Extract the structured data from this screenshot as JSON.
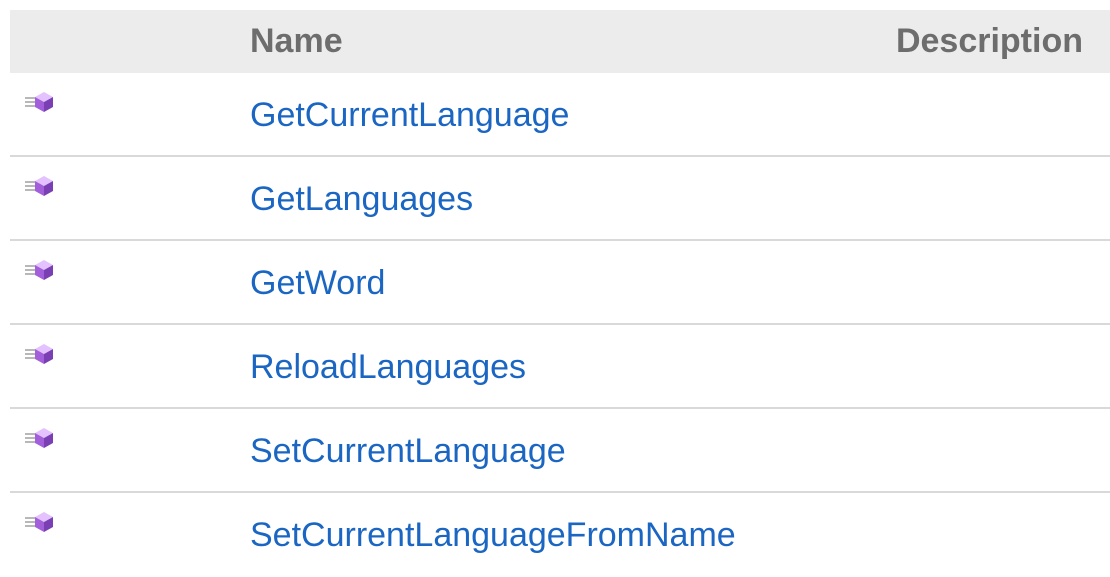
{
  "table": {
    "headers": {
      "icon": "",
      "name": "Name",
      "description": "Description"
    },
    "rows": [
      {
        "icon": "public-method-icon",
        "name": "GetCurrentLanguage",
        "description": ""
      },
      {
        "icon": "public-method-icon",
        "name": "GetLanguages",
        "description": ""
      },
      {
        "icon": "public-method-icon",
        "name": "GetWord",
        "description": ""
      },
      {
        "icon": "public-method-icon",
        "name": "ReloadLanguages",
        "description": ""
      },
      {
        "icon": "public-method-icon",
        "name": "SetCurrentLanguage",
        "description": ""
      },
      {
        "icon": "public-method-icon",
        "name": "SetCurrentLanguageFromName",
        "description": ""
      }
    ]
  },
  "colors": {
    "header_bg": "#ececec",
    "header_text": "#6d6d6d",
    "link": "#1a66c2",
    "divider": "#d9d9d9",
    "icon_purple": "#a35fd9"
  }
}
